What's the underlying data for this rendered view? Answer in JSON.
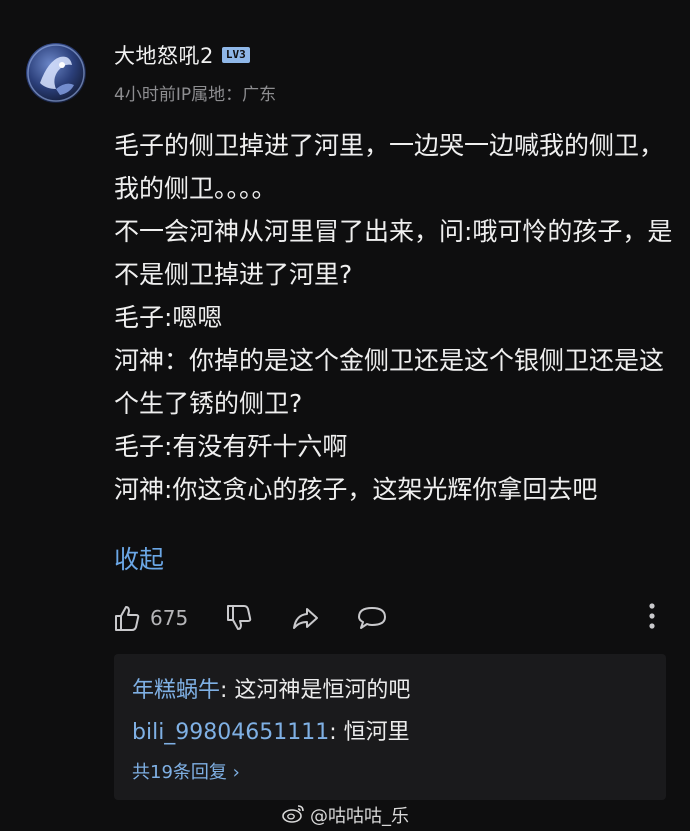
{
  "user": {
    "name": "大地怒吼2",
    "level": "LV3",
    "time": "4小时前",
    "ip_label": "IP属地：广东"
  },
  "comment": {
    "lines": [
      "毛子的侧卫掉进了河里，一边哭一边喊我的侧卫，我的侧卫。。。。",
      "不一会河神从河里冒了出来，问:哦可怜的孩子，是不是侧卫掉进了河里?",
      "毛子:嗯嗯",
      "河神：你掉的是这个金侧卫还是这个银侧卫还是这个生了锈的侧卫?",
      "毛子:有没有歼十六啊",
      "河神:你这贪心的孩子，这架光辉你拿回去吧"
    ],
    "collapse_label": "收起"
  },
  "actions": {
    "like_count": "675",
    "icons": [
      "thumb-up-icon",
      "thumb-down-icon",
      "share-icon",
      "comment-icon",
      "more-vertical-icon"
    ]
  },
  "replies": {
    "items": [
      {
        "user": "年糕蜗牛",
        "text": ": 这河神是恒河的吧"
      },
      {
        "user": "bili_99804651111",
        "text": ": 恒河里"
      }
    ],
    "view_all": "共19条回复 ›"
  },
  "watermark": {
    "text": "@咕咕咕_乐",
    "icon": "weibo-icon"
  },
  "colors": {
    "background": "#0e0e0f",
    "link": "#6ba7e6",
    "reply_user": "#7fb0e4",
    "reply_box": "#1a1a1c"
  }
}
